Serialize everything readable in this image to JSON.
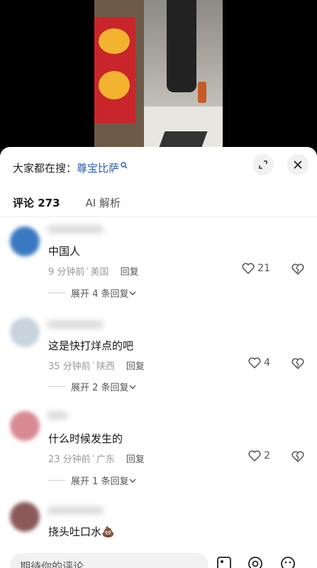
{
  "video": {
    "label": ""
  },
  "header": {
    "search_prefix": "大家都在搜：",
    "search_term": "尊宝比萨",
    "expand_icon": "expand-icon",
    "close_icon": "close-icon"
  },
  "tabs": [
    {
      "label": "评论 273",
      "active": true
    },
    {
      "label": "AI 解析",
      "active": false
    }
  ],
  "comments": [
    {
      "text": "中国人",
      "time": "9 分钟前",
      "location": "美国",
      "reply": "回复",
      "likes": "21",
      "expand": "展开 4 条回复",
      "avatar_color": "#3a78c2"
    },
    {
      "text": "这是快打烊点的吧",
      "time": "35 分钟前",
      "location": "陕西",
      "reply": "回复",
      "likes": "4",
      "expand": "展开 2 条回复",
      "avatar_color": "#c9d3dd"
    },
    {
      "text": "什么时候发生的",
      "time": "23 分钟前",
      "location": "广东",
      "reply": "回复",
      "likes": "2",
      "expand": "展开 1 条回复",
      "avatar_color": "#d88a94"
    },
    {
      "text": "挠头吐口水💩",
      "time": "",
      "location": "",
      "reply": "",
      "likes": "",
      "expand": "",
      "avatar_color": "#8a5a5a"
    }
  ],
  "input": {
    "placeholder": "期待你的评论"
  },
  "icons": {
    "like": "heart-icon",
    "dislike": "broken-heart-icon",
    "chevron": "chevron-down-icon",
    "image": "image-icon",
    "at": "at-icon",
    "emoji": "emoji-icon"
  },
  "colors": {
    "link": "#2a5db0",
    "text": "#161616",
    "muted": "#999999",
    "sheet": "#ffffff"
  }
}
